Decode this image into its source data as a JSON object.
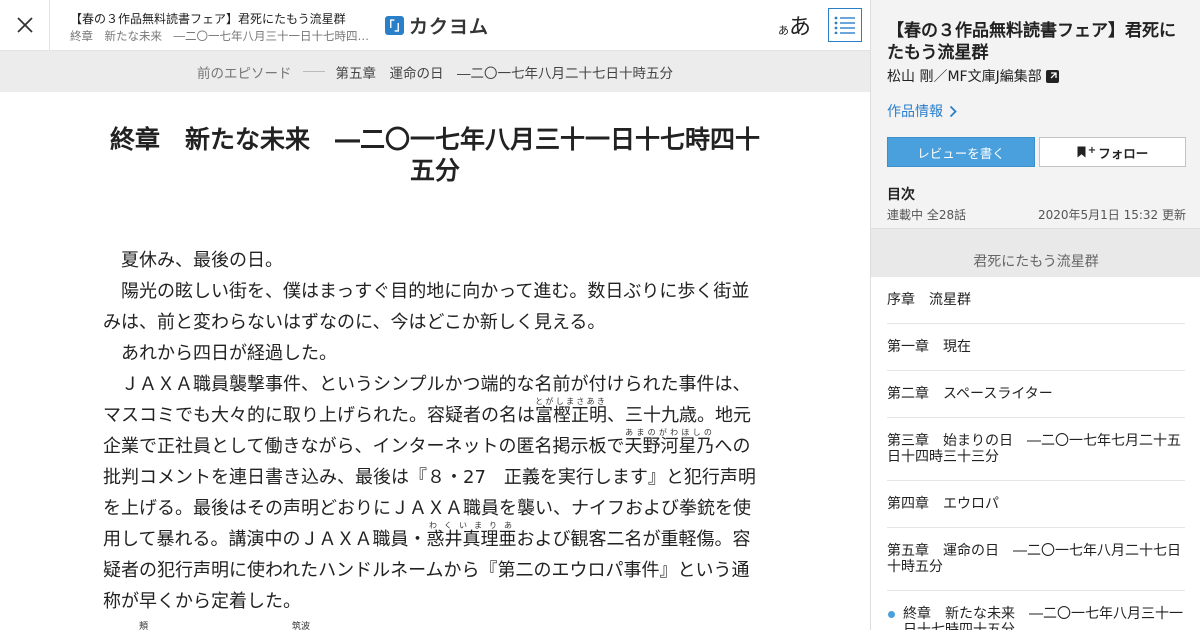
{
  "header": {
    "close_label": "閉じる",
    "work_title": "【春の３作品無料読書フェア】君死にたもう流星群",
    "episode_title": "終章　新たな未来　―二〇一七年八月三十一日十七時四十…",
    "logo_mark": "「」",
    "logo_text": "カクヨム",
    "font_small": "あ",
    "font_big": "あ"
  },
  "epnav": {
    "prev_label": "前のエピソード",
    "current_label": "第五章　運命の日　―二〇一七年八月二十七日十時五分"
  },
  "episode": {
    "title_line1": "終章　新たな未来　―二〇一七年八月三十一日十七時四十",
    "title_line2": "五分",
    "paragraphs": [
      {
        "text": "　夏休み、最後の日。"
      },
      {
        "text": "　陽光の眩しい街を、僕はまっすぐ目的地に向かって進む。数日ぶりに歩く街並みは、前と変わらないはずなのに、今はどこか新しく見える。"
      },
      {
        "text": "　あれから四日が経過した。"
      },
      {
        "pre": "　ＪＡＸＡ職員襲撃事件、というシンプルかつ端的な名前が付けられた事件は、マスコミでも大々的に取り上げられた。容疑者の名は",
        "ruby1": "富樫正明",
        "rt1": "とがしまさあき",
        "mid1": "、三十九歳。地元企業で正社員として働きながら、インターネットの匿名掲示板で",
        "ruby2": "天野河星乃",
        "rt2": "あまのがわほしの",
        "mid2": "への批判コメントを連日書き込み、最後は『８・27　正義を実行します』と犯行声明を上げる。最後はその声明どおりにＪＡＸＡ職員を襲い、ナイフおよび拳銃を使用して暴れる。講演中のＪＡＸＡ職員・",
        "ruby3": "惑井真理亜",
        "rt3": "わくいまりあ",
        "post": "および観客二名が重軽傷。容疑者の犯行声明に使われたハンドルネームから『第二のエウロパ事件』という通称が早くから定着した。"
      },
      {
        "text": "　　　　頬　　　　　　　　　　　　　　　　筑波"
      }
    ]
  },
  "sidebar": {
    "title": "【春の３作品無料読書フェア】君死にたもう流星群",
    "author": "松山 剛／MF文庫J編集部",
    "info_label": "作品情報",
    "review_button": "レビューを書く",
    "follow_button": "フォロー",
    "follow_plus": "+",
    "toc_heading": "目次",
    "status": "連載中 全28話",
    "updated": "2020年5月1日 15:32 更新",
    "group_title": "君死にたもう流星群",
    "chapters": [
      {
        "label": "序章　流星群"
      },
      {
        "label": "第一章　現在"
      },
      {
        "label": "第二章　スペースライター"
      },
      {
        "label": "第三章　始まりの日　―二〇一七年七月二十五日十四時三十三分"
      },
      {
        "label": "第四章　エウロパ"
      },
      {
        "label": "第五章　運命の日　―二〇一七年八月二十七日十時五分"
      },
      {
        "label": "終章　新たな未来　―二〇一七年八月三十一日十七時四十五分",
        "current": true
      }
    ]
  },
  "colors": {
    "accent": "#2a7fc9",
    "review_button": "#4a9fdd"
  }
}
